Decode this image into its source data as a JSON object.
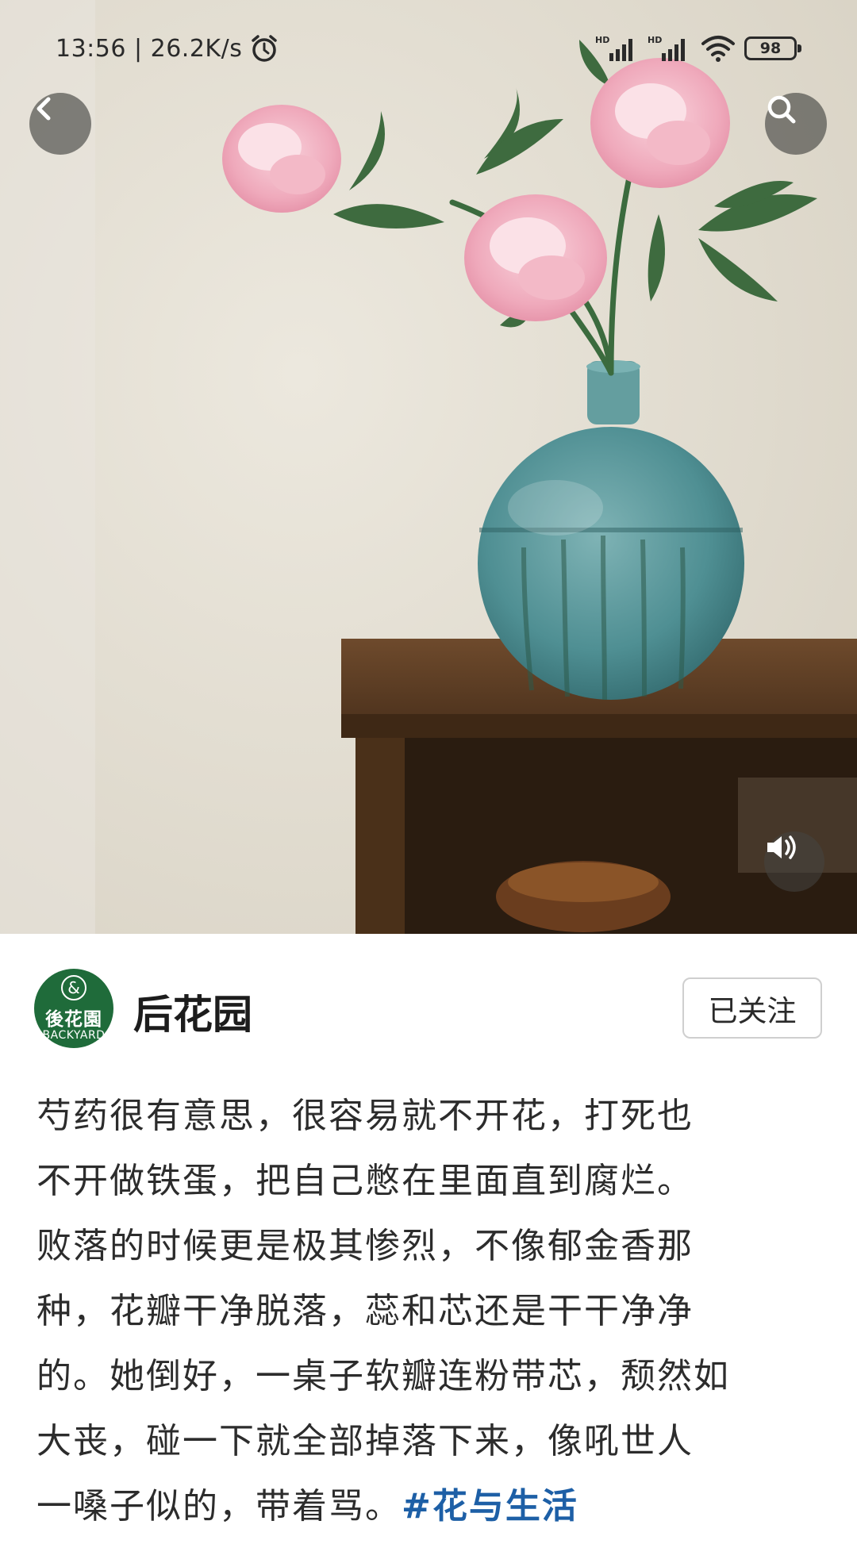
{
  "status_bar": {
    "time_speed": "13:56 | 26.2K/s",
    "signal_label_1": "HD",
    "signal_label_2": "HD",
    "battery": "98"
  },
  "photo": {
    "description_icons": [
      "back-arrow-icon",
      "search-icon",
      "sound-icon"
    ]
  },
  "author": {
    "name": "后花园",
    "avatar_cn": "後花園",
    "avatar_en": "BACKYARD",
    "avatar_symbol": "&",
    "follow_label": "已关注"
  },
  "post": {
    "lines": [
      "芍药很有意思，很容易就不开花，打死也",
      "不开做铁蛋，把自己憋在里面直到腐烂。",
      "败落的时候更是极其惨烈，不像郁金香那",
      "种，花瓣干净脱落，蕊和芯还是干干净净",
      "的。她倒好，一桌子软瓣连粉带芯，颓然如",
      "大丧，碰一下就全部掉落下来，像吼世人",
      "一嗓子似的，带着骂。"
    ],
    "hashtag": "#花与生活"
  },
  "colors": {
    "hashtag": "#1d5fa6",
    "avatar_bg": "#1f6b3a",
    "overlay_button": "#555550"
  }
}
